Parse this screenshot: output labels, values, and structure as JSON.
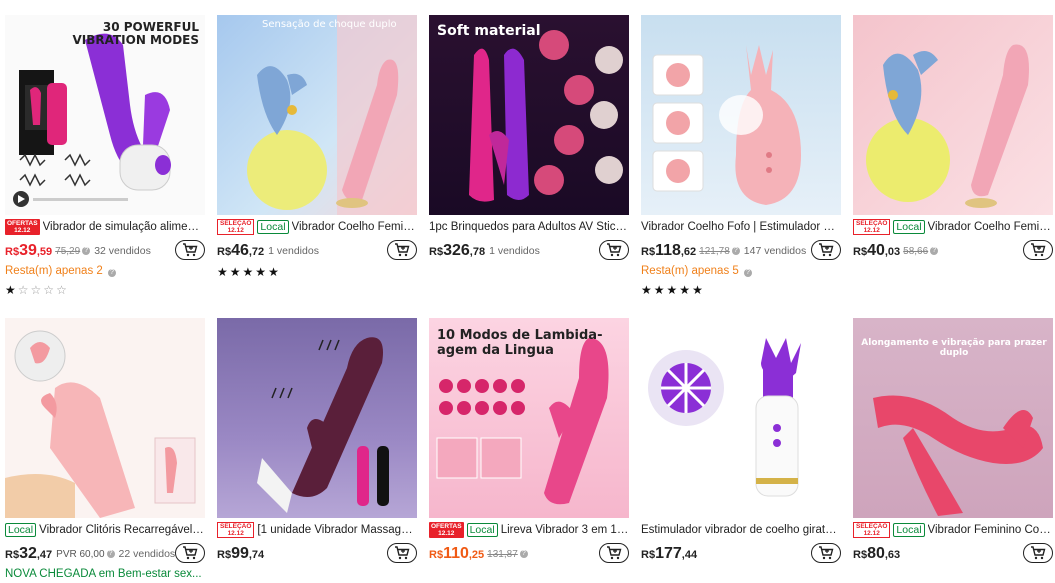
{
  "products": [
    {
      "image_text": "30 POWERFUL\nVIBRATION MODES",
      "badges": [
        "OFERTAS 12.12"
      ],
      "title": "Vibrador de simulação aliment...",
      "price_currency": "R$",
      "price_int": "39",
      "price_dec": ",59",
      "price_color": "red",
      "old_price": "75,29",
      "sold": "32 vendidos",
      "note": "Resta(m) apenas 2",
      "note_color": "orange",
      "stars_text": "★☆☆☆☆"
    },
    {
      "image_text": "Sensação de choque duplo",
      "badges": [
        "SELEÇÃO 12.12",
        "Local"
      ],
      "title": "Vibrador Coelho Feminin...",
      "price_currency": "R$",
      "price_int": "46",
      "price_dec": ",72",
      "price_color": "normal",
      "old_price": "",
      "sold": "1 vendidos",
      "stars_text": "★★★★★"
    },
    {
      "image_text": "Soft material",
      "badges": [],
      "title": "1pc Brinquedos para Adultos AV Stick ...",
      "price_currency": "R$",
      "price_int": "326",
      "price_dec": ",78",
      "price_color": "normal",
      "old_price": "",
      "sold": "1 vendidos"
    },
    {
      "image_text": "",
      "badges": [],
      "title": "Vibrador Coelho Fofo | Estimulador Clit...",
      "price_currency": "R$",
      "price_int": "118",
      "price_dec": ",62",
      "price_color": "normal",
      "old_price": "121,78",
      "sold": "147 vendidos",
      "note": "Resta(m) apenas 5",
      "note_color": "orange",
      "stars_text": "★★★★★"
    },
    {
      "image_text": "",
      "badges": [
        "SELEÇÃO 12.12",
        "Local"
      ],
      "title": "Vibrador Coelho Feminin...",
      "price_currency": "R$",
      "price_int": "40",
      "price_dec": ",03",
      "price_color": "normal",
      "old_price": "58,66",
      "sold": ""
    },
    {
      "image_text": "",
      "badges": [
        "Local"
      ],
      "title": "Vibrador Clitóris Recarregável 3 ...",
      "price_currency": "R$",
      "price_int": "32",
      "price_dec": ",47",
      "price_color": "normal",
      "old_price": "",
      "extra": "PVR 60,00",
      "sold": "22 vendidos",
      "note": "NOVA CHEGADA em Bem-estar sex...",
      "note_color": "green"
    },
    {
      "image_text": "",
      "badges": [
        "SELEÇÃO 12.12"
      ],
      "title": "[1 unidade Vibrador Massagead...",
      "price_currency": "R$",
      "price_int": "99",
      "price_dec": ",74",
      "price_color": "normal",
      "old_price": "",
      "sold": ""
    },
    {
      "image_text": "10 Modos de Lambida-\nagem da Lingua",
      "badges": [
        "OFERTAS 12.12",
        "Local"
      ],
      "title": "Lireva Vibrador 3 em 1 c...",
      "price_currency": "R$",
      "price_int": "110",
      "price_dec": ",25",
      "price_color": "orange",
      "old_price": "131,87",
      "sold": ""
    },
    {
      "image_text": "",
      "badges": [],
      "title": "Estimulador vibrador de coelho giratóri...",
      "price_currency": "R$",
      "price_int": "177",
      "price_dec": ",44",
      "price_color": "normal",
      "old_price": "",
      "sold": ""
    },
    {
      "image_text": "Alongamento e vibração para prazer duplo",
      "badges": [
        "SELEÇÃO 12.12",
        "Local"
      ],
      "title": "Vibrador Feminino Coelh...",
      "price_currency": "R$",
      "price_int": "80",
      "price_dec": ",63",
      "price_color": "normal",
      "old_price": "",
      "sold": ""
    }
  ],
  "colors": {
    "price_red": "#e8212a",
    "price_orange": "#f05a14",
    "local_green": "#0a8a3a",
    "stock_orange": "#f0801a"
  }
}
